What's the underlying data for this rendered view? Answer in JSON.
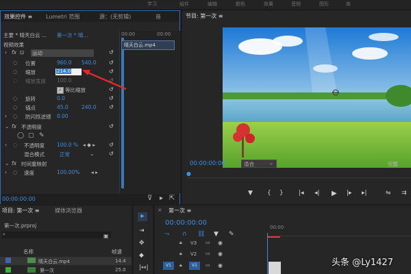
{
  "topbar": {
    "tabs": [
      "学习",
      "组件",
      "编辑",
      "颜色",
      "效果",
      "音频",
      "图形",
      "库"
    ]
  },
  "effect_controls": {
    "tabs": [
      "效果控件 ≡",
      "Lumetri 范围",
      "源：(无剪辑)",
      "音"
    ],
    "master_label": "主要 * 晴天白云 ...",
    "sequence_label": "第一次 * 晴...",
    "section_video": "视频效果",
    "clip_name": "晴天白云.mp4",
    "motion": "运动",
    "position": {
      "label": "位置",
      "x": "960.0",
      "y": "540.0"
    },
    "scale": {
      "label": "缩放",
      "value": "214.0"
    },
    "scale_width": {
      "label": "缩放宽度",
      "value": "100.0"
    },
    "uniform_scale": "等比缩放",
    "rotation": {
      "label": "旋转",
      "value": "0.0"
    },
    "anchor": {
      "label": "锚点",
      "x": "45.0",
      "y": "240.0"
    },
    "antiflicker": {
      "label": "防闪烁滤镜",
      "value": "0.00"
    },
    "opacity_section": "不透明度",
    "opacity": {
      "label": "不透明度",
      "value": "100.0 %"
    },
    "blend_mode": {
      "label": "混合模式",
      "value": "正常"
    },
    "time_remap": "时间重映射",
    "speed": {
      "label": "速度",
      "value": "100.00%"
    },
    "timecode": "00:00:00:00",
    "ruler_start": "00:00",
    "ruler_end": "00:00"
  },
  "program_monitor": {
    "title": "节目: 第一次 ≡",
    "timecode": "00:00:00:00",
    "fit": "适合",
    "quality": "完整"
  },
  "project": {
    "tabs": [
      "项目: 第一次 ≡",
      "媒体浏览器"
    ],
    "project_file": "第一次.prproj",
    "col_name": "名称",
    "col_fps": "帧速",
    "items": [
      {
        "name": "晴天白云.mp4",
        "fps": "14.4"
      },
      {
        "name": "第一次",
        "fps": "25.0"
      }
    ]
  },
  "timeline": {
    "title": "第一次 ≡",
    "timecode": "00:00:00:00",
    "ruler": "00:00",
    "tracks": [
      "V3",
      "V2",
      "V1"
    ]
  },
  "watermark": "头条 @Ly1427",
  "colors": {
    "accent_blue": "#2f7fd8",
    "playhead_red": "#e23a3a"
  }
}
